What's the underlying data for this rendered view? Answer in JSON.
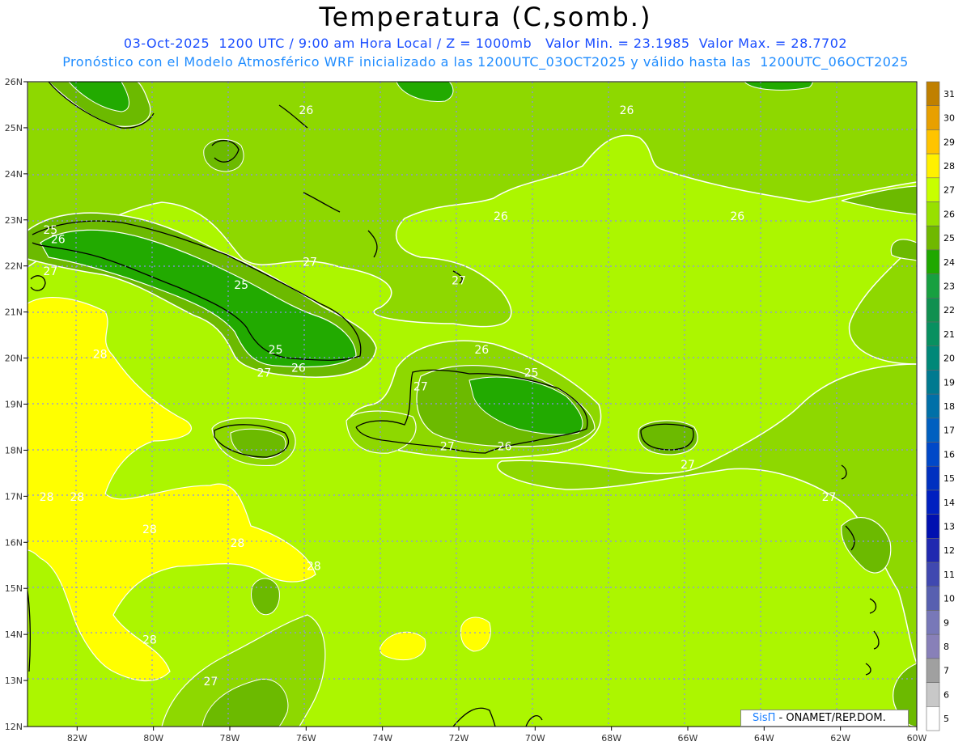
{
  "header": {
    "title": "Temperatura (C,somb.)",
    "line1": "03-Oct-2025  1200 UTC / 9:00 am Hora Local / Z = 1000mb   Valor Min. = 23.1985  Valor Max. = 28.7702",
    "line2": "Pronóstico con el Modelo Atmosférico WRF inicializado a las 1200UTC_03OCT2025 y válido hasta las  1200UTC_06OCT2025"
  },
  "axes": {
    "lat_labels": [
      "26N",
      "25N",
      "24N",
      "23N",
      "22N",
      "21N",
      "20N",
      "19N",
      "18N",
      "17N",
      "16N",
      "15N",
      "14N",
      "13N",
      "12N"
    ],
    "lon_labels": [
      "82W",
      "80W",
      "78W",
      "76W",
      "74W",
      "72W",
      "70W",
      "68W",
      "66W",
      "64W",
      "62W",
      "60W"
    ]
  },
  "colorbar": {
    "labels": [
      "31",
      "30",
      "29",
      "28",
      "27",
      "26",
      "25",
      "24",
      "23",
      "22",
      "21",
      "20",
      "19",
      "18",
      "17",
      "16",
      "15",
      "14",
      "13",
      "12",
      "11",
      "10",
      "9",
      "8",
      "7",
      "6",
      "5"
    ],
    "colors": [
      "#c08000",
      "#e8a000",
      "#ffc400",
      "#fff000",
      "#c8ff00",
      "#98e000",
      "#70b800",
      "#20a800",
      "#18a040",
      "#109050",
      "#089060",
      "#008878",
      "#007a90",
      "#0070a8",
      "#0060c0",
      "#0048c8",
      "#0030c0",
      "#0020c0",
      "#0010b0",
      "#2028b0",
      "#4048b0",
      "#5860b0",
      "#7878b8",
      "#8880b8",
      "#a0a0a0",
      "#c8c8c8",
      "#ffffff"
    ]
  },
  "contour_labels": [
    {
      "text": "26",
      "lon": -76,
      "lat": 25.3
    },
    {
      "text": "26",
      "lon": -67.6,
      "lat": 25.3
    },
    {
      "text": "26",
      "lon": -70.9,
      "lat": 23.0
    },
    {
      "text": "26",
      "lon": -64.7,
      "lat": 23.0
    },
    {
      "text": "25",
      "lon": -82.7,
      "lat": 22.7
    },
    {
      "text": "26",
      "lon": -82.5,
      "lat": 22.5
    },
    {
      "text": "27",
      "lon": -82.7,
      "lat": 21.8
    },
    {
      "text": "27",
      "lon": -75.9,
      "lat": 22.0
    },
    {
      "text": "25",
      "lon": -77.7,
      "lat": 21.5
    },
    {
      "text": "27",
      "lon": -72.0,
      "lat": 21.6
    },
    {
      "text": "25",
      "lon": -76.8,
      "lat": 20.1
    },
    {
      "text": "26",
      "lon": -76.2,
      "lat": 19.7
    },
    {
      "text": "27",
      "lon": -77.1,
      "lat": 19.6
    },
    {
      "text": "28",
      "lon": -81.4,
      "lat": 20.0
    },
    {
      "text": "26",
      "lon": -71.4,
      "lat": 20.1
    },
    {
      "text": "25",
      "lon": -70.1,
      "lat": 19.6
    },
    {
      "text": "27",
      "lon": -73.0,
      "lat": 19.3
    },
    {
      "text": "27",
      "lon": -72.3,
      "lat": 18.0
    },
    {
      "text": "26",
      "lon": -70.8,
      "lat": 18.0
    },
    {
      "text": "27",
      "lon": -66.0,
      "lat": 17.6
    },
    {
      "text": "27",
      "lon": -62.3,
      "lat": 16.9
    },
    {
      "text": "28",
      "lon": -82.8,
      "lat": 16.9
    },
    {
      "text": "28",
      "lon": -82.0,
      "lat": 16.9
    },
    {
      "text": "28",
      "lon": -80.1,
      "lat": 16.2
    },
    {
      "text": "28",
      "lon": -77.8,
      "lat": 15.9
    },
    {
      "text": "28",
      "lon": -75.8,
      "lat": 15.4
    },
    {
      "text": "28",
      "lon": -80.1,
      "lat": 13.8
    },
    {
      "text": "27",
      "lon": -78.5,
      "lat": 12.9
    }
  ],
  "credit": {
    "brand": "SisΠ",
    "text": " - ONAMET/REP.DOM."
  }
}
